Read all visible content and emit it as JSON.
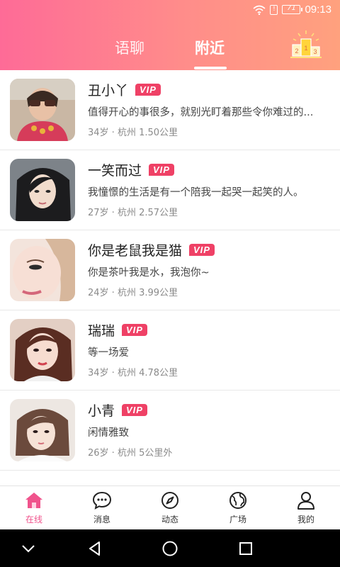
{
  "status_bar": {
    "time": "09:13",
    "battery": "71",
    "sim": "!"
  },
  "header": {
    "tabs": [
      {
        "label": "语聊",
        "active": false
      },
      {
        "label": "附近",
        "active": true
      }
    ],
    "rank_icon": "leaderboard-icon",
    "rank_digits": [
      "2",
      "1",
      "3"
    ]
  },
  "users": [
    {
      "name": "丑小丫",
      "vip": "VIP",
      "signature": "值得开心的事很多，就别光盯着那些令你难过的...",
      "meta": "34岁 · 杭州 1.50公里"
    },
    {
      "name": "一笑而过",
      "vip": "VIP",
      "signature": "我憧憬的生活是有一个陪我一起哭一起笑的人。",
      "meta": "27岁 · 杭州 2.57公里"
    },
    {
      "name": "你是老鼠我是猫",
      "vip": "VIP",
      "signature": "你是茶叶我是水，我泡你~",
      "meta": "24岁 · 杭州 3.99公里"
    },
    {
      "name": "瑞瑞",
      "vip": "VIP",
      "signature": "等一场爱",
      "meta": "34岁 · 杭州 4.78公里"
    },
    {
      "name": "小青",
      "vip": "VIP",
      "signature": "闲情雅致",
      "meta": "26岁 · 杭州 5公里外"
    }
  ],
  "bottom_nav": [
    {
      "label": "在线",
      "icon": "home-icon",
      "active": true
    },
    {
      "label": "消息",
      "icon": "message-icon",
      "active": false
    },
    {
      "label": "动态",
      "icon": "compass-icon",
      "active": false
    },
    {
      "label": "广场",
      "icon": "globe-icon",
      "active": false
    },
    {
      "label": "我的",
      "icon": "user-icon",
      "active": false
    }
  ],
  "colors": {
    "accent": "#f0538c",
    "vip": "#ef4166",
    "header_start": "#fe6b97",
    "header_end": "#ffa17e"
  }
}
